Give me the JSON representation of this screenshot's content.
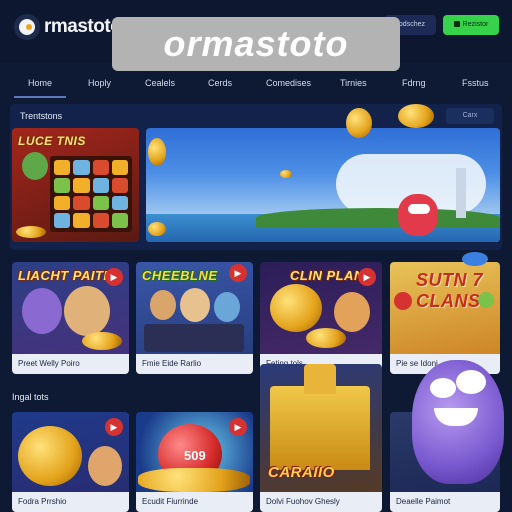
{
  "header": {
    "logo_text": "rmastoto",
    "banner_title": "ormastoto",
    "login_label": "Lodschez",
    "signup_label": "Rezistor"
  },
  "nav": {
    "items": [
      "Home",
      "Hoply",
      "Cealels",
      "Cerds",
      "Comedises",
      "Tirnies",
      "Fdrng",
      "Fsstus"
    ]
  },
  "featured": {
    "title": "Trentstons",
    "see_all": "Carx",
    "promo_heading": "LUCE TNIS"
  },
  "games_row1": [
    {
      "heading": "LIACHT PAITE",
      "caption": "Preet Welly Poiro"
    },
    {
      "heading": "CHEEBLNE",
      "caption": "Fmie Eide Rarlio"
    },
    {
      "heading": "CLIN PLANS",
      "caption": "Feting tols"
    },
    {
      "heading": "SUTN 7 CLANS",
      "caption": "Pie se Idoni"
    }
  ],
  "section2": {
    "title": "Ingal tots"
  },
  "games_row2": [
    {
      "heading": "",
      "caption": "Fodra Prrshio"
    },
    {
      "heading": "509",
      "caption": "Ecudit Fiurrinde"
    },
    {
      "heading": "CARAIIO",
      "caption": "Dolvi Fuohov Ghesly"
    },
    {
      "heading": "",
      "caption": "Deaelle Paimot"
    }
  ],
  "colors": {
    "background": "#0e1a33",
    "accent_green": "#36d24a",
    "coin_gold": "#e3a21a",
    "flag_red": "#d63232"
  }
}
